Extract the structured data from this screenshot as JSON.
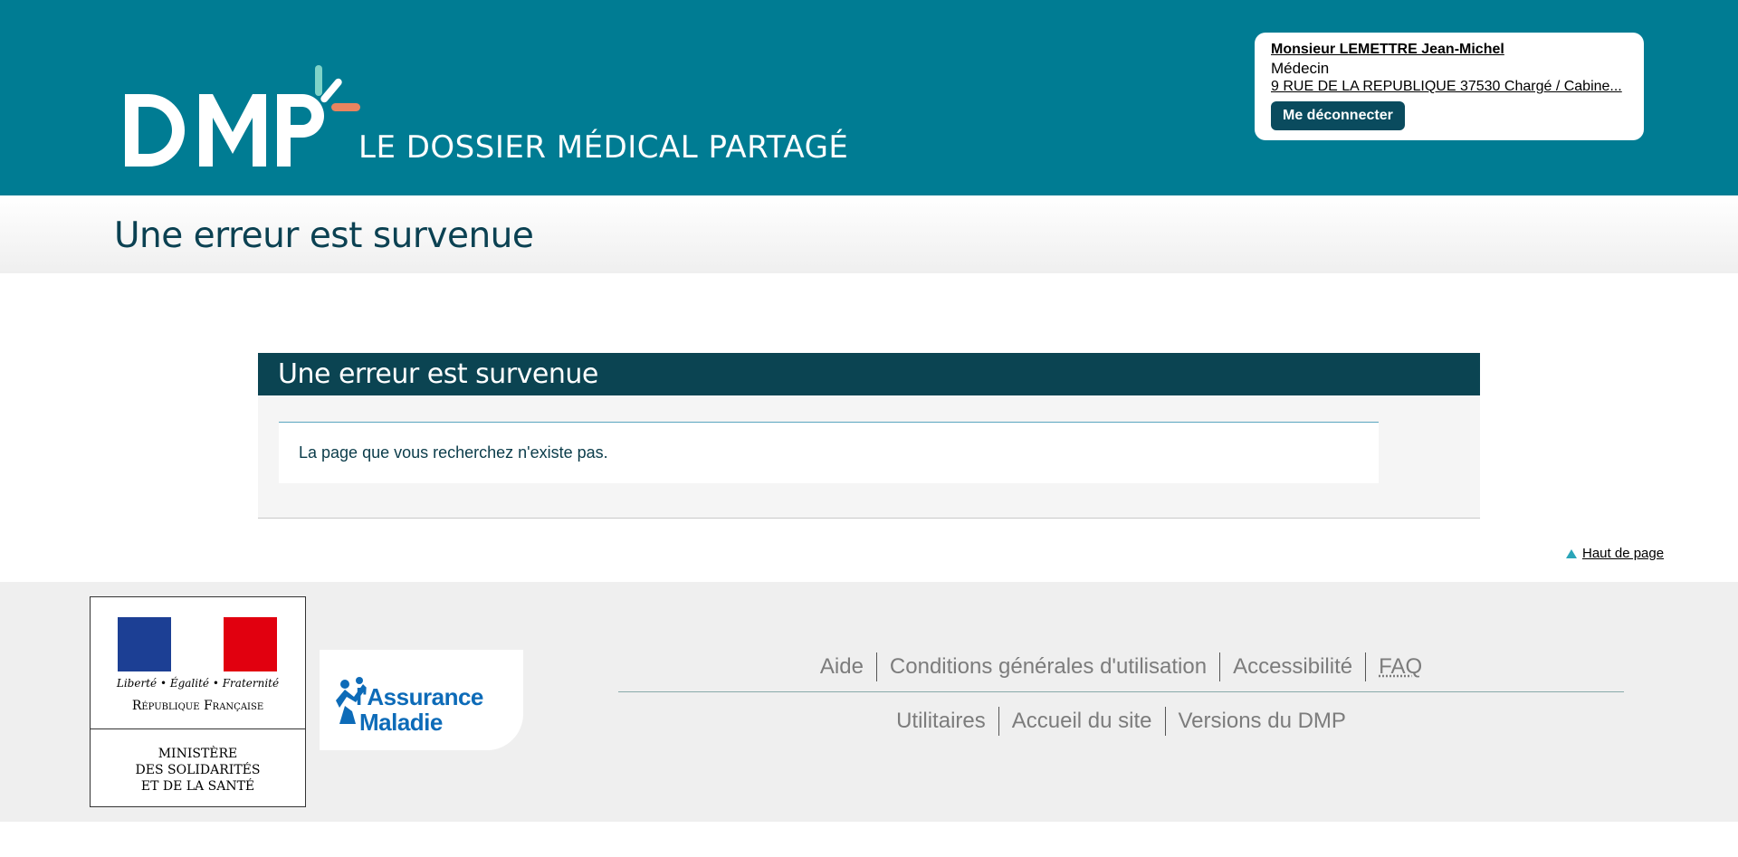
{
  "header": {
    "logo_text": "DMP",
    "tagline": "LE DOSSIER MÉDICAL PARTAGÉ",
    "colors": {
      "header_bg": "#007c93",
      "accent_green": "#7fd3c8",
      "accent_orange": "#e9845f"
    }
  },
  "user": {
    "name": "Monsieur LEMETTRE Jean-Michel",
    "role": "Médecin",
    "address": "9 RUE DE LA REPUBLIQUE 37530 Chargé / Cabine...",
    "logout_label": "Me déconnecter"
  },
  "page": {
    "title": "Une erreur est survenue"
  },
  "error_panel": {
    "title": "Une erreur est survenue",
    "message": "La page que vous recherchez n'existe pas."
  },
  "back_to_top": {
    "label": "Haut de page",
    "icon": "triangle-up-icon"
  },
  "footer": {
    "rf_logo": {
      "devise": "Liberté • Égalité • Fraternité",
      "republique": "République Française",
      "ministere": [
        "MINISTÈRE",
        "DES SOLIDARITÉS",
        "ET DE LA SANTÉ"
      ]
    },
    "ameli_logo": {
      "line1": "l'Assurance",
      "line2": "Maladie"
    },
    "links_row1": [
      "Aide",
      "Conditions générales d'utilisation",
      "Accessibilité",
      "FAQ"
    ],
    "links_row2": [
      "Utilitaires",
      "Accueil du site",
      "Versions du DMP"
    ]
  }
}
